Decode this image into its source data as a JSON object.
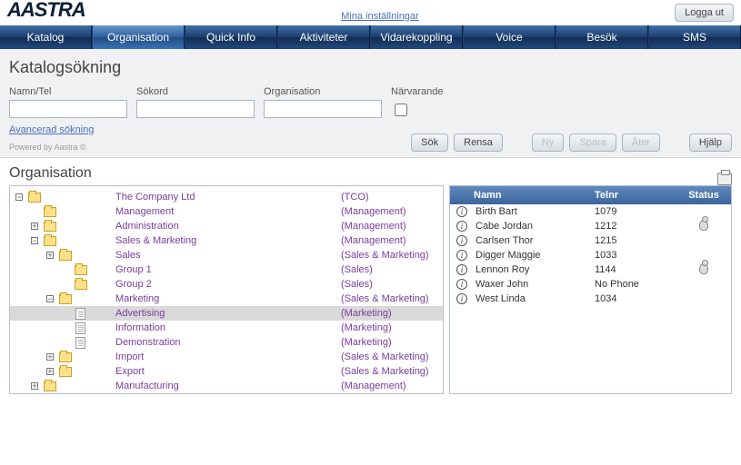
{
  "topbar": {
    "logo_text": "AASTRA",
    "settings_link": "Mina inställningar",
    "logout": "Logga ut"
  },
  "nav": {
    "items": [
      "Katalog",
      "Organisation",
      "Quick Info",
      "Aktiviteter",
      "Vidarekoppling",
      "Voice",
      "Besök",
      "SMS"
    ],
    "active_index": 1
  },
  "search": {
    "title": "Katalogsökning",
    "labels": {
      "name_tel": "Namn/Tel",
      "keyword": "Sökord",
      "organisation": "Organisation",
      "present": "Närvarande"
    },
    "values": {
      "name_tel": "",
      "keyword": "",
      "organisation": "",
      "present": false
    },
    "advanced_link": "Avancerad sökning",
    "powered_by": "Powered by Aastra ©",
    "buttons": {
      "search": "Sök",
      "clear": "Rensa",
      "new_": "Ny",
      "save": "Spara",
      "reset": "Åter",
      "help": "Hjälp"
    }
  },
  "org": {
    "title": "Organisation",
    "tree": [
      {
        "indent": 0,
        "toggle": "minus",
        "icon": "folder",
        "label": "The Company Ltd",
        "parent": "(TCO)",
        "selected": false
      },
      {
        "indent": 1,
        "toggle": "none",
        "icon": "folder",
        "label": "Management",
        "parent": "(Management)"
      },
      {
        "indent": 1,
        "toggle": "plus",
        "icon": "folder",
        "label": "Administration",
        "parent": "(Management)"
      },
      {
        "indent": 1,
        "toggle": "minus",
        "icon": "folder",
        "label": "Sales & Marketing",
        "parent": "(Management)"
      },
      {
        "indent": 2,
        "toggle": "plus",
        "icon": "folder",
        "label": "Sales",
        "parent": "(Sales & Marketing)"
      },
      {
        "indent": 3,
        "toggle": "none",
        "icon": "folder",
        "label": "Group 1",
        "parent": "(Sales)"
      },
      {
        "indent": 3,
        "toggle": "none",
        "icon": "folder",
        "label": "Group 2",
        "parent": "(Sales)"
      },
      {
        "indent": 2,
        "toggle": "minus",
        "icon": "folder",
        "label": "Marketing",
        "parent": "(Sales & Marketing)"
      },
      {
        "indent": 3,
        "toggle": "none",
        "icon": "doc",
        "label": "Advertising",
        "parent": "(Marketing)",
        "selected": true
      },
      {
        "indent": 3,
        "toggle": "none",
        "icon": "doc",
        "label": "Information",
        "parent": "(Marketing)"
      },
      {
        "indent": 3,
        "toggle": "none",
        "icon": "doc",
        "label": "Demonstration",
        "parent": "(Marketing)"
      },
      {
        "indent": 2,
        "toggle": "plus",
        "icon": "folder",
        "label": "Import",
        "parent": "(Sales & Marketing)"
      },
      {
        "indent": 2,
        "toggle": "plus",
        "icon": "folder",
        "label": "Export",
        "parent": "(Sales & Marketing)"
      },
      {
        "indent": 1,
        "toggle": "plus",
        "icon": "folder",
        "label": "Manufacturing",
        "parent": "(Management)"
      }
    ]
  },
  "contacts": {
    "headers": {
      "name": "Namn",
      "tel": "Telnr",
      "status": "Status"
    },
    "rows": [
      {
        "name": "Birth Bart",
        "tel": "1079",
        "presence": false
      },
      {
        "name": "Cabe Jordan",
        "tel": "1212",
        "presence": true
      },
      {
        "name": "Carlsen Thor",
        "tel": "1215",
        "presence": false
      },
      {
        "name": "Digger Maggie",
        "tel": "1033",
        "presence": false
      },
      {
        "name": "Lennon Roy",
        "tel": "1144",
        "presence": true
      },
      {
        "name": "Waxer John",
        "tel": "No Phone",
        "presence": false
      },
      {
        "name": "West Linda",
        "tel": "1034",
        "presence": false
      }
    ]
  }
}
